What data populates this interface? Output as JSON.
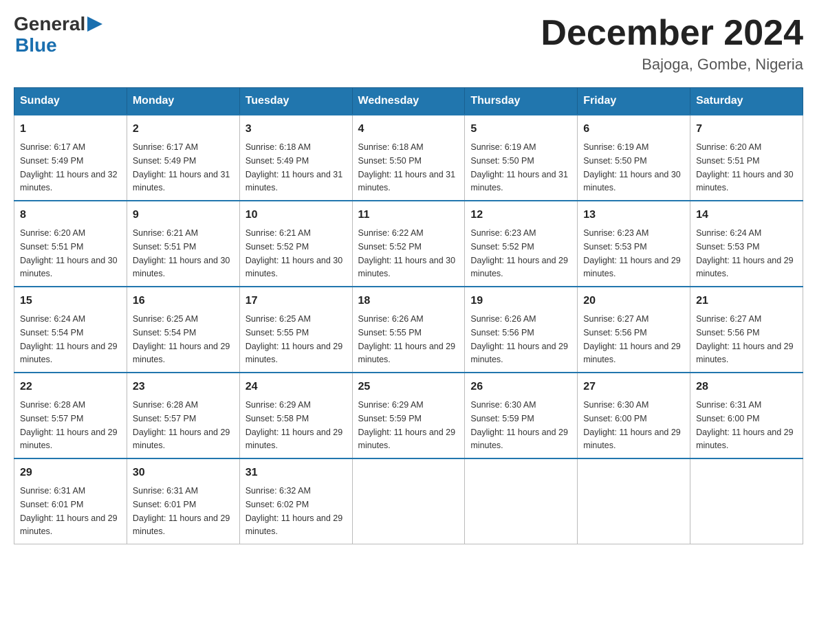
{
  "header": {
    "logo": {
      "line1": "General",
      "arrow": "▶",
      "line2": "Blue"
    },
    "title": "December 2024",
    "subtitle": "Bajoga, Gombe, Nigeria"
  },
  "days_of_week": [
    "Sunday",
    "Monday",
    "Tuesday",
    "Wednesday",
    "Thursday",
    "Friday",
    "Saturday"
  ],
  "weeks": [
    [
      {
        "day": "1",
        "sunrise": "6:17 AM",
        "sunset": "5:49 PM",
        "daylight": "11 hours and 32 minutes."
      },
      {
        "day": "2",
        "sunrise": "6:17 AM",
        "sunset": "5:49 PM",
        "daylight": "11 hours and 31 minutes."
      },
      {
        "day": "3",
        "sunrise": "6:18 AM",
        "sunset": "5:49 PM",
        "daylight": "11 hours and 31 minutes."
      },
      {
        "day": "4",
        "sunrise": "6:18 AM",
        "sunset": "5:50 PM",
        "daylight": "11 hours and 31 minutes."
      },
      {
        "day": "5",
        "sunrise": "6:19 AM",
        "sunset": "5:50 PM",
        "daylight": "11 hours and 31 minutes."
      },
      {
        "day": "6",
        "sunrise": "6:19 AM",
        "sunset": "5:50 PM",
        "daylight": "11 hours and 30 minutes."
      },
      {
        "day": "7",
        "sunrise": "6:20 AM",
        "sunset": "5:51 PM",
        "daylight": "11 hours and 30 minutes."
      }
    ],
    [
      {
        "day": "8",
        "sunrise": "6:20 AM",
        "sunset": "5:51 PM",
        "daylight": "11 hours and 30 minutes."
      },
      {
        "day": "9",
        "sunrise": "6:21 AM",
        "sunset": "5:51 PM",
        "daylight": "11 hours and 30 minutes."
      },
      {
        "day": "10",
        "sunrise": "6:21 AM",
        "sunset": "5:52 PM",
        "daylight": "11 hours and 30 minutes."
      },
      {
        "day": "11",
        "sunrise": "6:22 AM",
        "sunset": "5:52 PM",
        "daylight": "11 hours and 30 minutes."
      },
      {
        "day": "12",
        "sunrise": "6:23 AM",
        "sunset": "5:52 PM",
        "daylight": "11 hours and 29 minutes."
      },
      {
        "day": "13",
        "sunrise": "6:23 AM",
        "sunset": "5:53 PM",
        "daylight": "11 hours and 29 minutes."
      },
      {
        "day": "14",
        "sunrise": "6:24 AM",
        "sunset": "5:53 PM",
        "daylight": "11 hours and 29 minutes."
      }
    ],
    [
      {
        "day": "15",
        "sunrise": "6:24 AM",
        "sunset": "5:54 PM",
        "daylight": "11 hours and 29 minutes."
      },
      {
        "day": "16",
        "sunrise": "6:25 AM",
        "sunset": "5:54 PM",
        "daylight": "11 hours and 29 minutes."
      },
      {
        "day": "17",
        "sunrise": "6:25 AM",
        "sunset": "5:55 PM",
        "daylight": "11 hours and 29 minutes."
      },
      {
        "day": "18",
        "sunrise": "6:26 AM",
        "sunset": "5:55 PM",
        "daylight": "11 hours and 29 minutes."
      },
      {
        "day": "19",
        "sunrise": "6:26 AM",
        "sunset": "5:56 PM",
        "daylight": "11 hours and 29 minutes."
      },
      {
        "day": "20",
        "sunrise": "6:27 AM",
        "sunset": "5:56 PM",
        "daylight": "11 hours and 29 minutes."
      },
      {
        "day": "21",
        "sunrise": "6:27 AM",
        "sunset": "5:56 PM",
        "daylight": "11 hours and 29 minutes."
      }
    ],
    [
      {
        "day": "22",
        "sunrise": "6:28 AM",
        "sunset": "5:57 PM",
        "daylight": "11 hours and 29 minutes."
      },
      {
        "day": "23",
        "sunrise": "6:28 AM",
        "sunset": "5:57 PM",
        "daylight": "11 hours and 29 minutes."
      },
      {
        "day": "24",
        "sunrise": "6:29 AM",
        "sunset": "5:58 PM",
        "daylight": "11 hours and 29 minutes."
      },
      {
        "day": "25",
        "sunrise": "6:29 AM",
        "sunset": "5:59 PM",
        "daylight": "11 hours and 29 minutes."
      },
      {
        "day": "26",
        "sunrise": "6:30 AM",
        "sunset": "5:59 PM",
        "daylight": "11 hours and 29 minutes."
      },
      {
        "day": "27",
        "sunrise": "6:30 AM",
        "sunset": "6:00 PM",
        "daylight": "11 hours and 29 minutes."
      },
      {
        "day": "28",
        "sunrise": "6:31 AM",
        "sunset": "6:00 PM",
        "daylight": "11 hours and 29 minutes."
      }
    ],
    [
      {
        "day": "29",
        "sunrise": "6:31 AM",
        "sunset": "6:01 PM",
        "daylight": "11 hours and 29 minutes."
      },
      {
        "day": "30",
        "sunrise": "6:31 AM",
        "sunset": "6:01 PM",
        "daylight": "11 hours and 29 minutes."
      },
      {
        "day": "31",
        "sunrise": "6:32 AM",
        "sunset": "6:02 PM",
        "daylight": "11 hours and 29 minutes."
      },
      null,
      null,
      null,
      null
    ]
  ]
}
